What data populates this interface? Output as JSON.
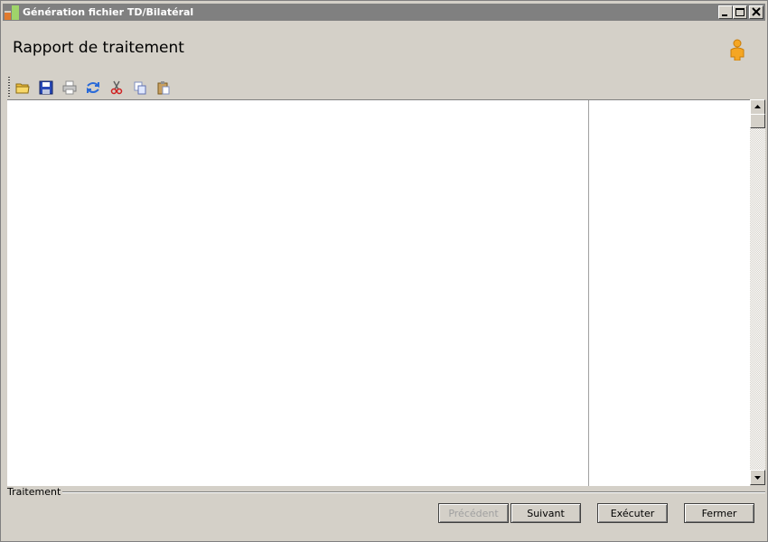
{
  "window": {
    "title": "Génération fichier TD/Bilatéral",
    "icons": {
      "app": "app-icon",
      "minimize": "minimize-icon",
      "maximize": "maximize-icon",
      "close": "close-icon"
    }
  },
  "header": {
    "title": "Rapport de traitement",
    "user_icon": "user-icon"
  },
  "toolbar": {
    "items": [
      "open-folder-icon",
      "save-icon",
      "print-icon",
      "refresh-icon",
      "cut-icon",
      "copy-icon",
      "paste-icon"
    ]
  },
  "status": {
    "label": "Traitement"
  },
  "buttons": {
    "previous": "Précédent",
    "next": "Suivant",
    "execute": "Exécuter",
    "close": "Fermer"
  }
}
